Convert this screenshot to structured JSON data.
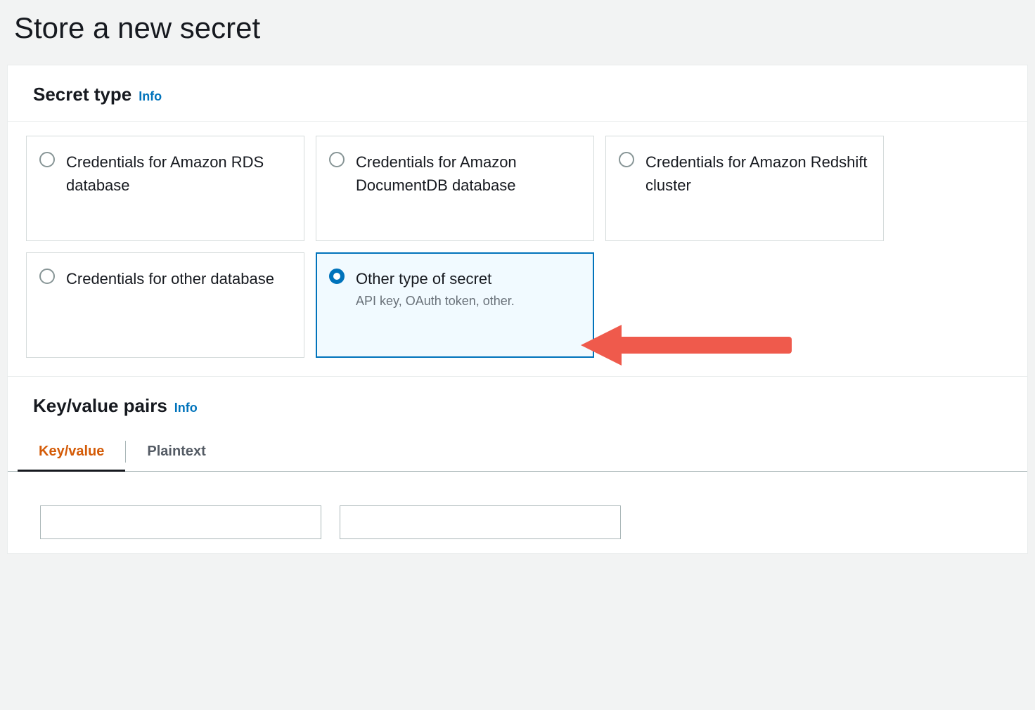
{
  "page": {
    "title": "Store a new secret"
  },
  "secret_type": {
    "heading": "Secret type",
    "info_label": "Info",
    "tiles": [
      {
        "label": "Credentials for Amazon RDS database",
        "desc": "",
        "selected": false
      },
      {
        "label": "Credentials for Amazon DocumentDB database",
        "desc": "",
        "selected": false
      },
      {
        "label": "Credentials for Amazon Redshift cluster",
        "desc": "",
        "selected": false
      },
      {
        "label": "Credentials for other database",
        "desc": "",
        "selected": false
      },
      {
        "label": "Other type of secret",
        "desc": "API key, OAuth token, other.",
        "selected": true
      }
    ]
  },
  "kv": {
    "heading": "Key/value pairs",
    "info_label": "Info",
    "tabs": [
      {
        "label": "Key/value",
        "active": true
      },
      {
        "label": "Plaintext",
        "active": false
      }
    ],
    "key_value": "",
    "value_value": "",
    "key_placeholder": "",
    "value_placeholder": ""
  },
  "colors": {
    "accent": "#0073bb",
    "tab_active": "#d45b07",
    "arrow": "#ef5a4c"
  }
}
